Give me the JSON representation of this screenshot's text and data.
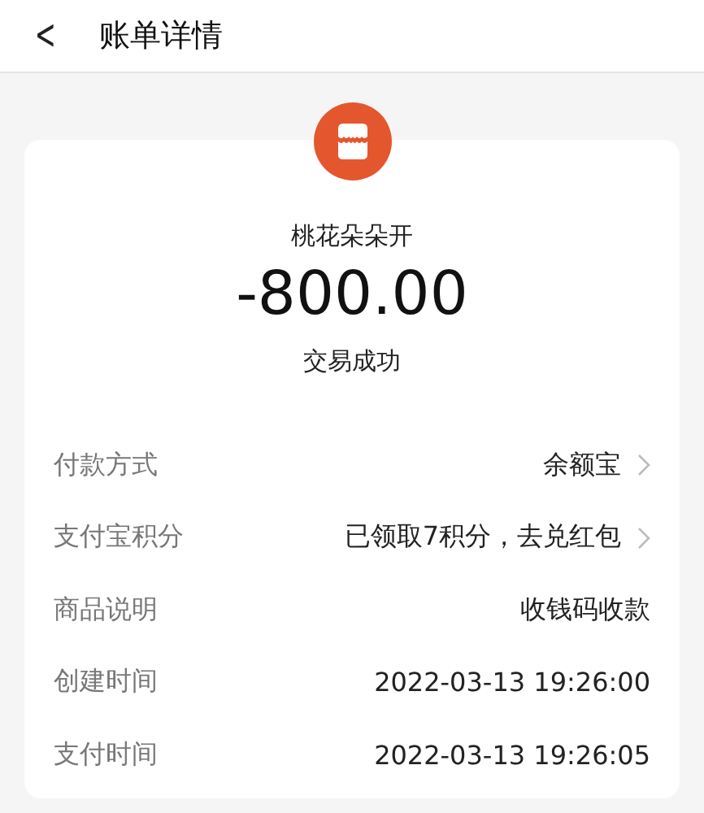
{
  "header": {
    "back": "<",
    "title": "账单详情"
  },
  "summary": {
    "merchant": "桃花朵朵开",
    "amount": "-800.00",
    "status": "交易成功"
  },
  "details": [
    {
      "label": "付款方式",
      "value": "余额宝",
      "kind": "link"
    },
    {
      "label": "支付宝积分",
      "value": "已领取7积分，去兑红包",
      "kind": "link"
    },
    {
      "label": "商品说明",
      "value": "收钱码收款",
      "kind": "plain"
    },
    {
      "label": "创建时间",
      "value": "2022-03-13 19:26:00",
      "kind": "plain"
    },
    {
      "label": "支付时间",
      "value": "2022-03-13 19:26:05",
      "kind": "plain"
    }
  ]
}
